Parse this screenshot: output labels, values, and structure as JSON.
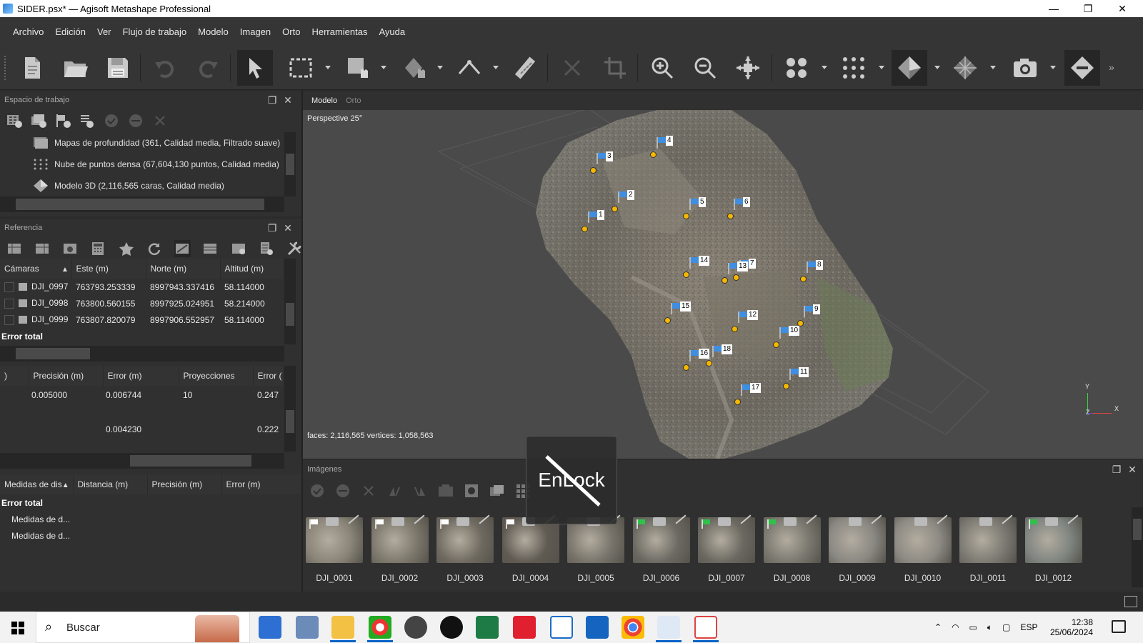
{
  "window": {
    "title": "SIDER.psx* — Agisoft Metashape Professional",
    "minimize": "—",
    "restore": "❐",
    "close": "✕"
  },
  "menu": [
    "Archivo",
    "Edición",
    "Ver",
    "Flujo de trabajo",
    "Modelo",
    "Imagen",
    "Orto",
    "Herramientas",
    "Ayuda"
  ],
  "workspace": {
    "title": "Espacio de trabajo",
    "items": [
      "Mapas de profundidad (361, Calidad media, Filtrado suave)",
      "Nube de puntos densa (67,604,130 puntos, Calidad media)",
      "Modelo 3D (2,116,565 caras, Calidad media)"
    ]
  },
  "reference": {
    "title": "Referencia",
    "camera_columns": [
      "Cámaras",
      "Este (m)",
      "Norte (m)",
      "Altitud (m)"
    ],
    "cameras": [
      {
        "name": "DJI_0997",
        "east": "763793.253339",
        "north": "8997943.337416",
        "alt": "58.114000"
      },
      {
        "name": "DJI_0998",
        "east": "763800.560155",
        "north": "8997925.024951",
        "alt": "58.214000"
      },
      {
        "name": "DJI_0999",
        "east": "763807.820079",
        "north": "8997906.552957",
        "alt": "58.114000"
      }
    ],
    "error_total": "Error total",
    "marker_columns": [
      ")",
      "Precisión (m)",
      "Error (m)",
      "Proyecciones",
      "Error ("
    ],
    "marker_rows": [
      {
        "c0": "",
        "precision": "0.005000",
        "error": "0.006744",
        "proj": "10",
        "err_px": "0.247"
      },
      {
        "c0": "",
        "precision": "",
        "error": "0.004230",
        "proj": "",
        "err_px": "0.222"
      }
    ],
    "measure_columns": [
      "Medidas de dis",
      "Distancia (m)",
      "Precisión (m)",
      "Error (m)"
    ],
    "measure_rows": [
      "Error total",
      "Medidas de d...",
      "Medidas de d..."
    ]
  },
  "viewport": {
    "tabs": [
      "Modelo",
      "Orto"
    ],
    "perspective": "Perspective 25°",
    "stats": "faces: 2,116,565 vertices: 1,058,563",
    "axis_y": "Y",
    "axis_x": "X",
    "axis_z": "Z",
    "markers": [
      "1",
      "2",
      "3",
      "4",
      "5",
      "6",
      "7",
      "8",
      "9",
      "10",
      "11",
      "12",
      "13",
      "14",
      "15",
      "16",
      "17",
      "18"
    ]
  },
  "images": {
    "title": "Imágenes",
    "items": [
      "DJI_0001",
      "DJI_0002",
      "DJI_0003",
      "DJI_0004",
      "DJI_0005",
      "DJI_0006",
      "DJI_0007",
      "DJI_0008",
      "DJI_0009",
      "DJI_0010",
      "DJI_0011",
      "DJI_0012"
    ]
  },
  "overlay": {
    "text": "EnLock"
  },
  "taskbar": {
    "search_placeholder": "Buscar",
    "lang": "ESP",
    "time": "12:38",
    "date": "25/06/2024"
  },
  "colors": {
    "accent_blue": "#2e7bd6",
    "marker_flag": "#3f8ee0",
    "marker_dot": "#f5b800"
  }
}
